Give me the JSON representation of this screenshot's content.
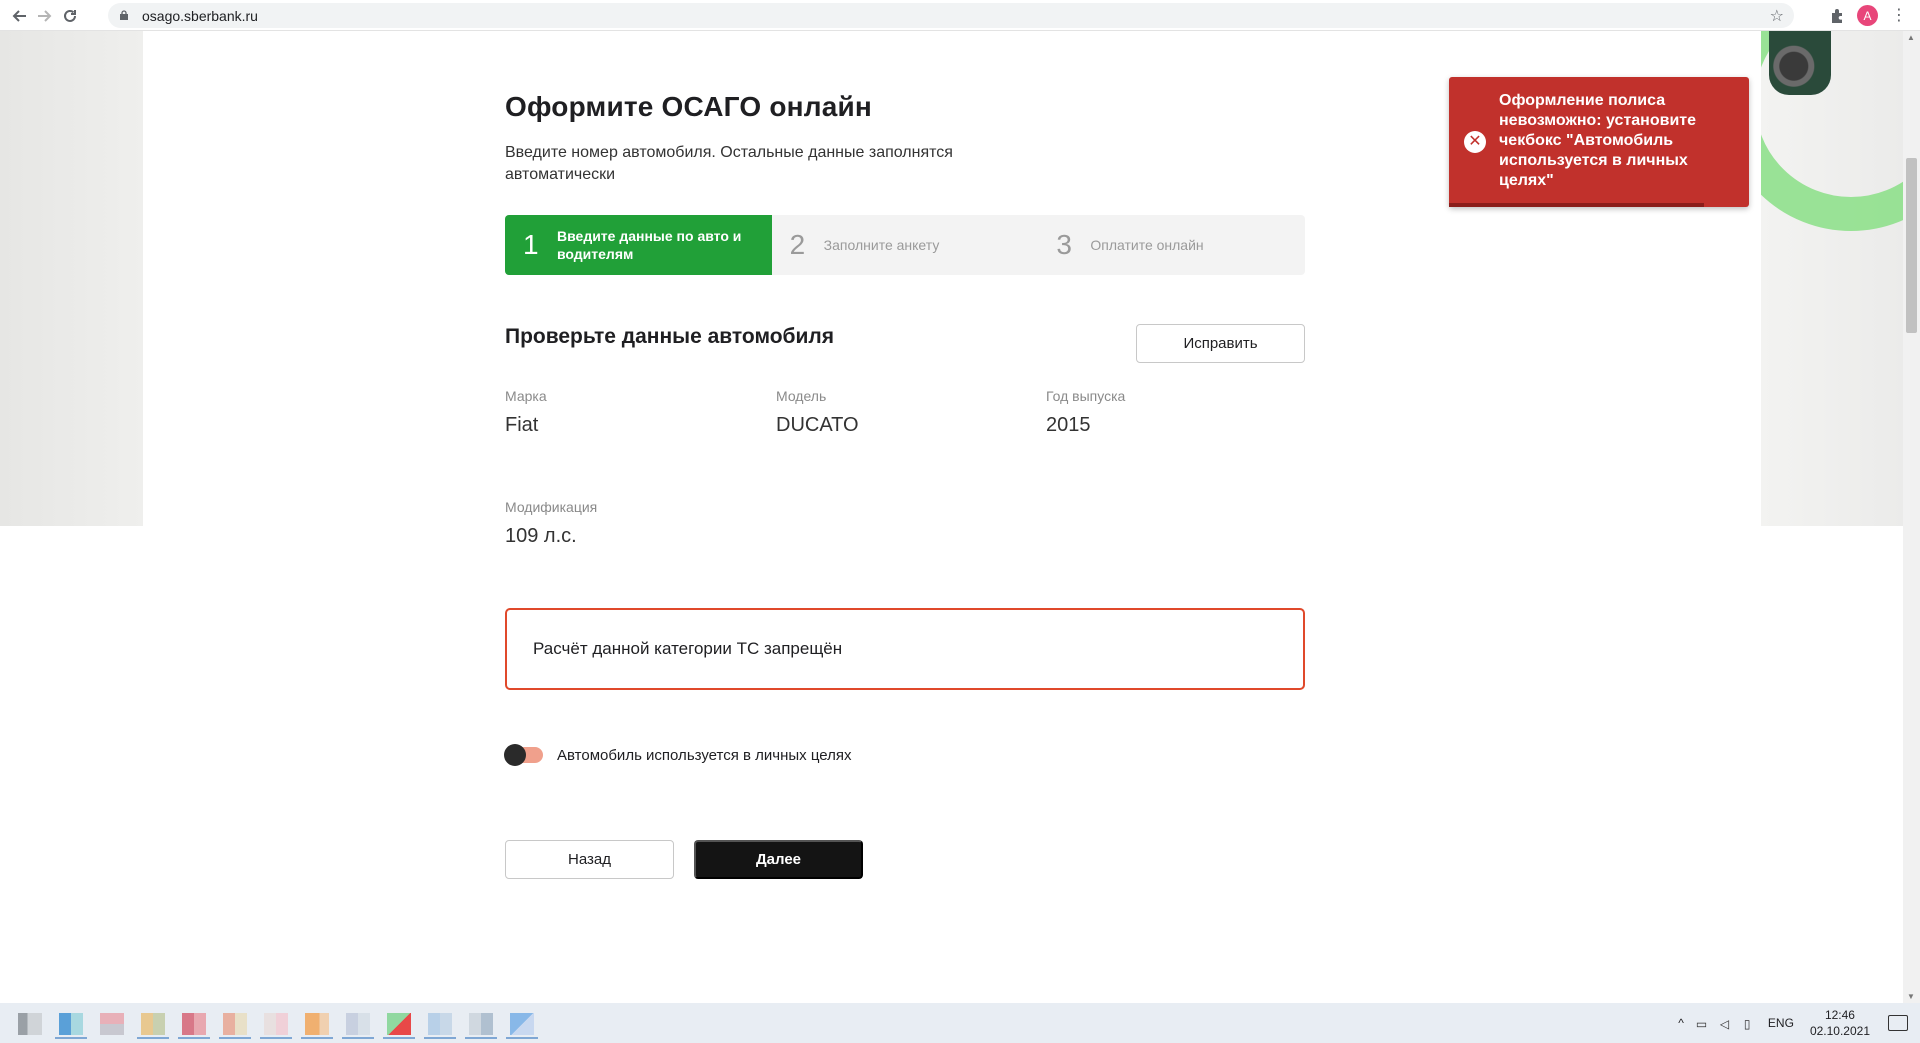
{
  "browser": {
    "url": "osago.sberbank.ru",
    "avatar_letter": "A"
  },
  "page": {
    "title": "Оформите ОСАГО онлайн",
    "subtitle": "Введите номер автомобиля. Остальные данные заполнятся автоматически",
    "steps": [
      {
        "num": "1",
        "label": "Введите данные по авто и водителям",
        "state": "active"
      },
      {
        "num": "2",
        "label": "Заполните анкету",
        "state": "inactive"
      },
      {
        "num": "3",
        "label": "Оплатите онлайн",
        "state": "inactive"
      }
    ],
    "section_title": "Проверьте данные автомобиля",
    "edit_button": "Исправить",
    "fields": {
      "brand": {
        "label": "Марка",
        "value": "Fiat"
      },
      "model": {
        "label": "Модель",
        "value": "DUCATO"
      },
      "year": {
        "label": "Год выпуска",
        "value": "2015"
      },
      "modification": {
        "label": "Модификация",
        "value": "109 л.с."
      }
    },
    "error_box": "Расчёт данной категории ТС запрещён",
    "personal_use": {
      "label": "Автомобиль используется в личных целях",
      "checked": false
    },
    "back_button": "Назад",
    "next_button": "Далее"
  },
  "toast": {
    "message": "Оформление полиса невозможно: установите чекбокс \"Автомобиль используется в личных целях\"",
    "icon": "error-x-icon",
    "color": "#c1312c",
    "progress": 0.85
  },
  "colors": {
    "accent_green": "#21a038",
    "error_red": "#e0492b",
    "primary_dark": "#141414"
  },
  "taskbar": {
    "lang": "ENG",
    "time": "12:46",
    "date": "02.10.2021"
  }
}
